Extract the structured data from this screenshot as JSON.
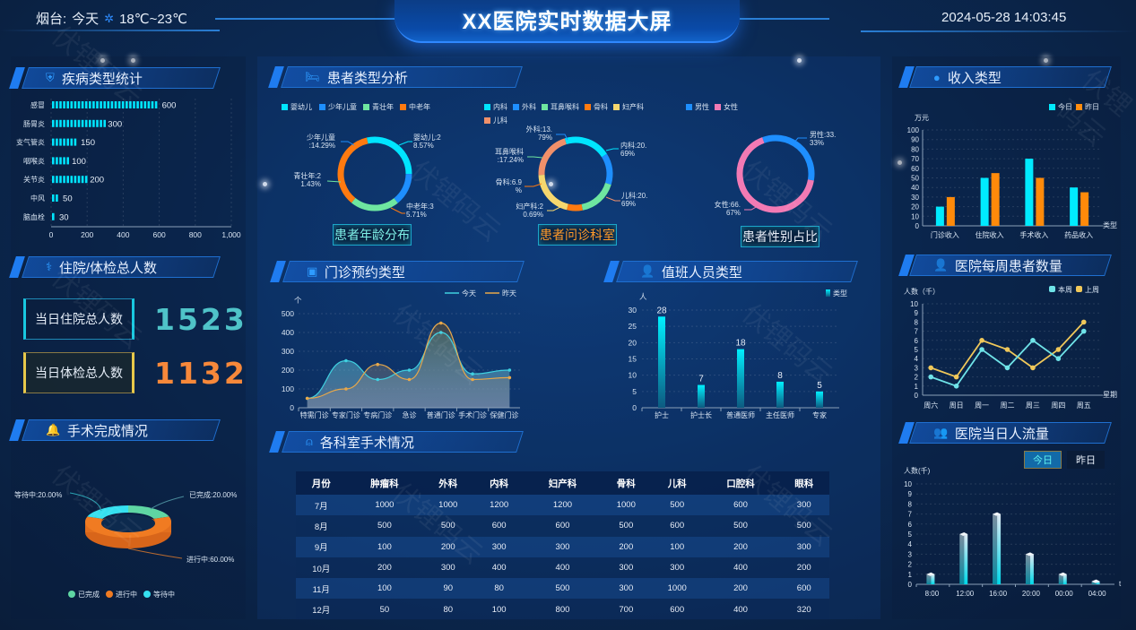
{
  "header": {
    "location": "烟台:",
    "day": "今天",
    "weather_icon": "sun-icon",
    "temperature": "18℃~23℃",
    "title": "XX医院实时数据大屏",
    "datetime": "2024-05-28 14:03:45"
  },
  "watermark": "伏锂码云",
  "panels": {
    "disease": {
      "title": "疾病类型统计",
      "icon": "shield-icon"
    },
    "inpatient": {
      "title": "住院/体检总人数",
      "icon": "stethoscope-icon"
    },
    "surgery_status": {
      "title": "手术完成情况",
      "icon": "bell-icon"
    },
    "patient_type": {
      "title": "患者类型分析",
      "icon": "bed-icon"
    },
    "outpatient": {
      "title": "门诊预约类型",
      "icon": "clipboard-icon"
    },
    "duty": {
      "title": "值班人员类型",
      "icon": "user-icon"
    },
    "dept_surgery": {
      "title": "各科室手术情况",
      "icon": "alarm-icon"
    },
    "income": {
      "title": "收入类型",
      "icon": "money-icon"
    },
    "weekly": {
      "title": "医院每周患者数量",
      "icon": "person-icon"
    },
    "flow": {
      "title": "医院当日人流量",
      "icon": "people-icon"
    }
  },
  "stats": {
    "inpatient_label": "当日住院总人数",
    "inpatient_value": "1523",
    "checkup_label": "当日体检总人数",
    "checkup_value": "1132",
    "inpatient_color": "#4fc3c8",
    "checkup_color": "#f7883a"
  },
  "pie_buttons": {
    "age": "患者年龄分布",
    "dept": "患者问诊科室",
    "gender": "患者性别占比"
  },
  "flow_buttons": {
    "today": "今日",
    "yesterday": "昨日"
  },
  "surgery_table": {
    "headers": [
      "月份",
      "肿瘤科",
      "外科",
      "内科",
      "妇产科",
      "骨科",
      "儿科",
      "口腔科",
      "眼科"
    ],
    "rows": [
      [
        "7月",
        "1000",
        "1000",
        "1200",
        "1200",
        "1000",
        "500",
        "600",
        "300"
      ],
      [
        "8月",
        "500",
        "500",
        "600",
        "600",
        "500",
        "600",
        "500",
        "500"
      ],
      [
        "9月",
        "100",
        "200",
        "300",
        "300",
        "200",
        "100",
        "200",
        "300"
      ],
      [
        "10月",
        "200",
        "300",
        "400",
        "400",
        "300",
        "300",
        "400",
        "200"
      ],
      [
        "11月",
        "100",
        "90",
        "80",
        "500",
        "300",
        "1000",
        "200",
        "600"
      ],
      [
        "12月",
        "50",
        "80",
        "100",
        "800",
        "700",
        "600",
        "400",
        "320"
      ]
    ]
  },
  "chart_data": [
    {
      "id": "disease",
      "type": "bar",
      "orientation": "horizontal",
      "categories": [
        "感冒",
        "肠胃炎",
        "支气管炎",
        "咽喉炎",
        "关节炎",
        "中风",
        "脑血栓"
      ],
      "values": [
        600,
        300,
        150,
        100,
        200,
        50,
        30
      ],
      "xlim": [
        0,
        1000
      ],
      "xticks": [
        "0",
        "200",
        "400",
        "600",
        "800",
        "1,000"
      ],
      "color": "#00e5ff"
    },
    {
      "id": "surgery_status",
      "type": "pie",
      "style": "3d-donut",
      "slices": [
        {
          "name": "已完成",
          "value": 20,
          "label": "已完成:20.00%",
          "color": "#5fd6a3"
        },
        {
          "name": "进行中",
          "value": 60,
          "label": "进行中:60.00%",
          "color": "#f07b22"
        },
        {
          "name": "等待中",
          "value": 20,
          "label": "等待中:20.00%",
          "color": "#35e0f0"
        }
      ],
      "legend": [
        "已完成",
        "进行中",
        "等待中"
      ],
      "legend_position": "bottom"
    },
    {
      "id": "age",
      "type": "pie",
      "style": "ring",
      "slices": [
        {
          "name": "婴幼儿",
          "value": 28.57,
          "label": "婴幼儿:28.57%",
          "color": "#00e5ff"
        },
        {
          "name": "少年儿童",
          "value": 14.29,
          "label": "少年儿童:14.29%",
          "color": "#1e8fff"
        },
        {
          "name": "青壮年",
          "value": 21.43,
          "label": "青壮年:21.43%",
          "color": "#6ee6a0"
        },
        {
          "name": "中老年",
          "value": 35.71,
          "label": "中老年:35.71%",
          "color": "#ff7a10"
        }
      ],
      "legend_position": "top"
    },
    {
      "id": "dept",
      "type": "pie",
      "style": "ring",
      "slices": [
        {
          "name": "内科",
          "value": 20.69,
          "label": "内科:20.69%",
          "color": "#00e5ff"
        },
        {
          "name": "外科",
          "value": 13.79,
          "label": "外科:13.79%",
          "color": "#1e8fff"
        },
        {
          "name": "耳鼻喉科",
          "value": 17.24,
          "label": "耳鼻喉科:17.24%",
          "color": "#6ee6a0"
        },
        {
          "name": "骨科",
          "value": 6.9,
          "label": "骨科:6.9%",
          "color": "#ff7a10"
        },
        {
          "name": "妇产科",
          "value": 20.69,
          "label": "妇产科:20.69%",
          "color": "#f5d76e"
        },
        {
          "name": "儿科",
          "value": 20.69,
          "label": "儿科:20.69%",
          "color": "#f0906a"
        }
      ],
      "legend_position": "top"
    },
    {
      "id": "gender",
      "type": "pie",
      "style": "ring",
      "slices": [
        {
          "name": "男性",
          "value": 33.33,
          "label": "男性:33.33%",
          "color": "#1e8fff"
        },
        {
          "name": "女性",
          "value": 66.67,
          "label": "女性:66.67%",
          "color": "#f27ab4"
        }
      ],
      "legend_position": "top"
    },
    {
      "id": "outpatient",
      "type": "area",
      "categories": [
        "特需门诊",
        "专家门诊",
        "专病门诊",
        "急诊",
        "普通门诊",
        "手术门诊",
        "保健门诊"
      ],
      "series": [
        {
          "name": "今天",
          "values": [
            50,
            250,
            150,
            200,
            400,
            180,
            200
          ],
          "color": "#3fd0e0"
        },
        {
          "name": "昨天",
          "values": [
            50,
            100,
            230,
            150,
            450,
            150,
            160
          ],
          "color": "#e8a84a"
        }
      ],
      "ylabel": "个",
      "ylim": [
        0,
        500
      ],
      "yticks": [
        0,
        100,
        200,
        300,
        400,
        500
      ],
      "legend_position": "top-right"
    },
    {
      "id": "duty",
      "type": "bar",
      "categories": [
        "护士",
        "护士长",
        "普通医师",
        "主任医师",
        "专家"
      ],
      "values": [
        28,
        7,
        18,
        8,
        5
      ],
      "series_name": "类型",
      "ylabel": "人",
      "ylim": [
        0,
        30
      ],
      "yticks": [
        0,
        5,
        10,
        15,
        20,
        25,
        30
      ],
      "color": "#00e5ff",
      "legend_position": "top-right"
    },
    {
      "id": "income",
      "type": "bar",
      "categories": [
        "门诊收入",
        "住院收入",
        "手术收入",
        "药品收入"
      ],
      "series": [
        {
          "name": "今日",
          "values": [
            20,
            50,
            70,
            40
          ],
          "color": "#00eaff"
        },
        {
          "name": "昨日",
          "values": [
            30,
            55,
            50,
            35
          ],
          "color": "#ff8a0a"
        }
      ],
      "ylabel": "万元",
      "xlabel": "类型",
      "ylim": [
        0,
        100
      ],
      "yticks": [
        0,
        10,
        20,
        30,
        40,
        50,
        60,
        70,
        80,
        90,
        100
      ],
      "legend_position": "top-right"
    },
    {
      "id": "weekly",
      "type": "line",
      "categories": [
        "周六",
        "周日",
        "周一",
        "周二",
        "周三",
        "周四",
        "周五"
      ],
      "series": [
        {
          "name": "本周",
          "values": [
            2,
            1,
            5,
            3,
            6,
            4,
            7
          ],
          "color": "#6fe3e8"
        },
        {
          "name": "上周",
          "values": [
            3,
            2,
            6,
            5,
            3,
            5,
            8
          ],
          "color": "#f0c85a"
        }
      ],
      "ylabel": "人数（千）",
      "xlabel": "星期",
      "ylim": [
        0,
        10
      ],
      "yticks": [
        0,
        1,
        2,
        3,
        4,
        5,
        6,
        7,
        8,
        9,
        10
      ],
      "legend_position": "top-right"
    },
    {
      "id": "flow",
      "type": "bar",
      "style": "3d",
      "categories": [
        "8:00",
        "12:00",
        "16:00",
        "20:00",
        "00:00",
        "04:00"
      ],
      "values": [
        1,
        5,
        7,
        3,
        1,
        0.3
      ],
      "ylabel": "人数(千)",
      "xlabel": "t",
      "ylim": [
        0,
        10
      ],
      "yticks": [
        0,
        1,
        2,
        3,
        4,
        5,
        6,
        7,
        8,
        9,
        10
      ],
      "color": "#00e5ff"
    }
  ]
}
